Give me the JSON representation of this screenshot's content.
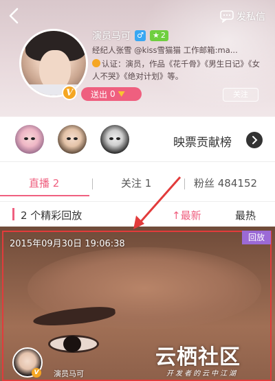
{
  "profile": {
    "name": "演员马可",
    "gender_symbol": "♂",
    "level": "2",
    "bio_line1": "经纪人张雪 @kiss雪猫猫 工作邮箱:ma...",
    "bio_line2": "认证：演员，作品《花千骨》《男生日记》《女人不哭》《绝对计划》等。",
    "avatar_badge": "V",
    "send_label": "送出",
    "send_count": "0",
    "follow_label": "关注",
    "message_label": "发私信"
  },
  "contributors": {
    "board_label": "映票贡献榜"
  },
  "tabs": [
    {
      "label": "直播 2"
    },
    {
      "label": "关注 1"
    },
    {
      "label": "粉丝 484152"
    }
  ],
  "replay": {
    "count_label": "2 个精彩回放",
    "sort_latest": "↑最新",
    "sort_hot": "最热"
  },
  "card": {
    "timestamp": "2015年09月30日 19:06:38",
    "tag": "回放",
    "streamer_name": "演员马可",
    "badge": "V"
  },
  "watermark": {
    "logo": "云栖社区",
    "sub": "开发者的云中江湖"
  },
  "colors": {
    "accent": "#ef5f7f",
    "replay_tag": "#9b6ad6",
    "annotation": "#e23b3b"
  }
}
